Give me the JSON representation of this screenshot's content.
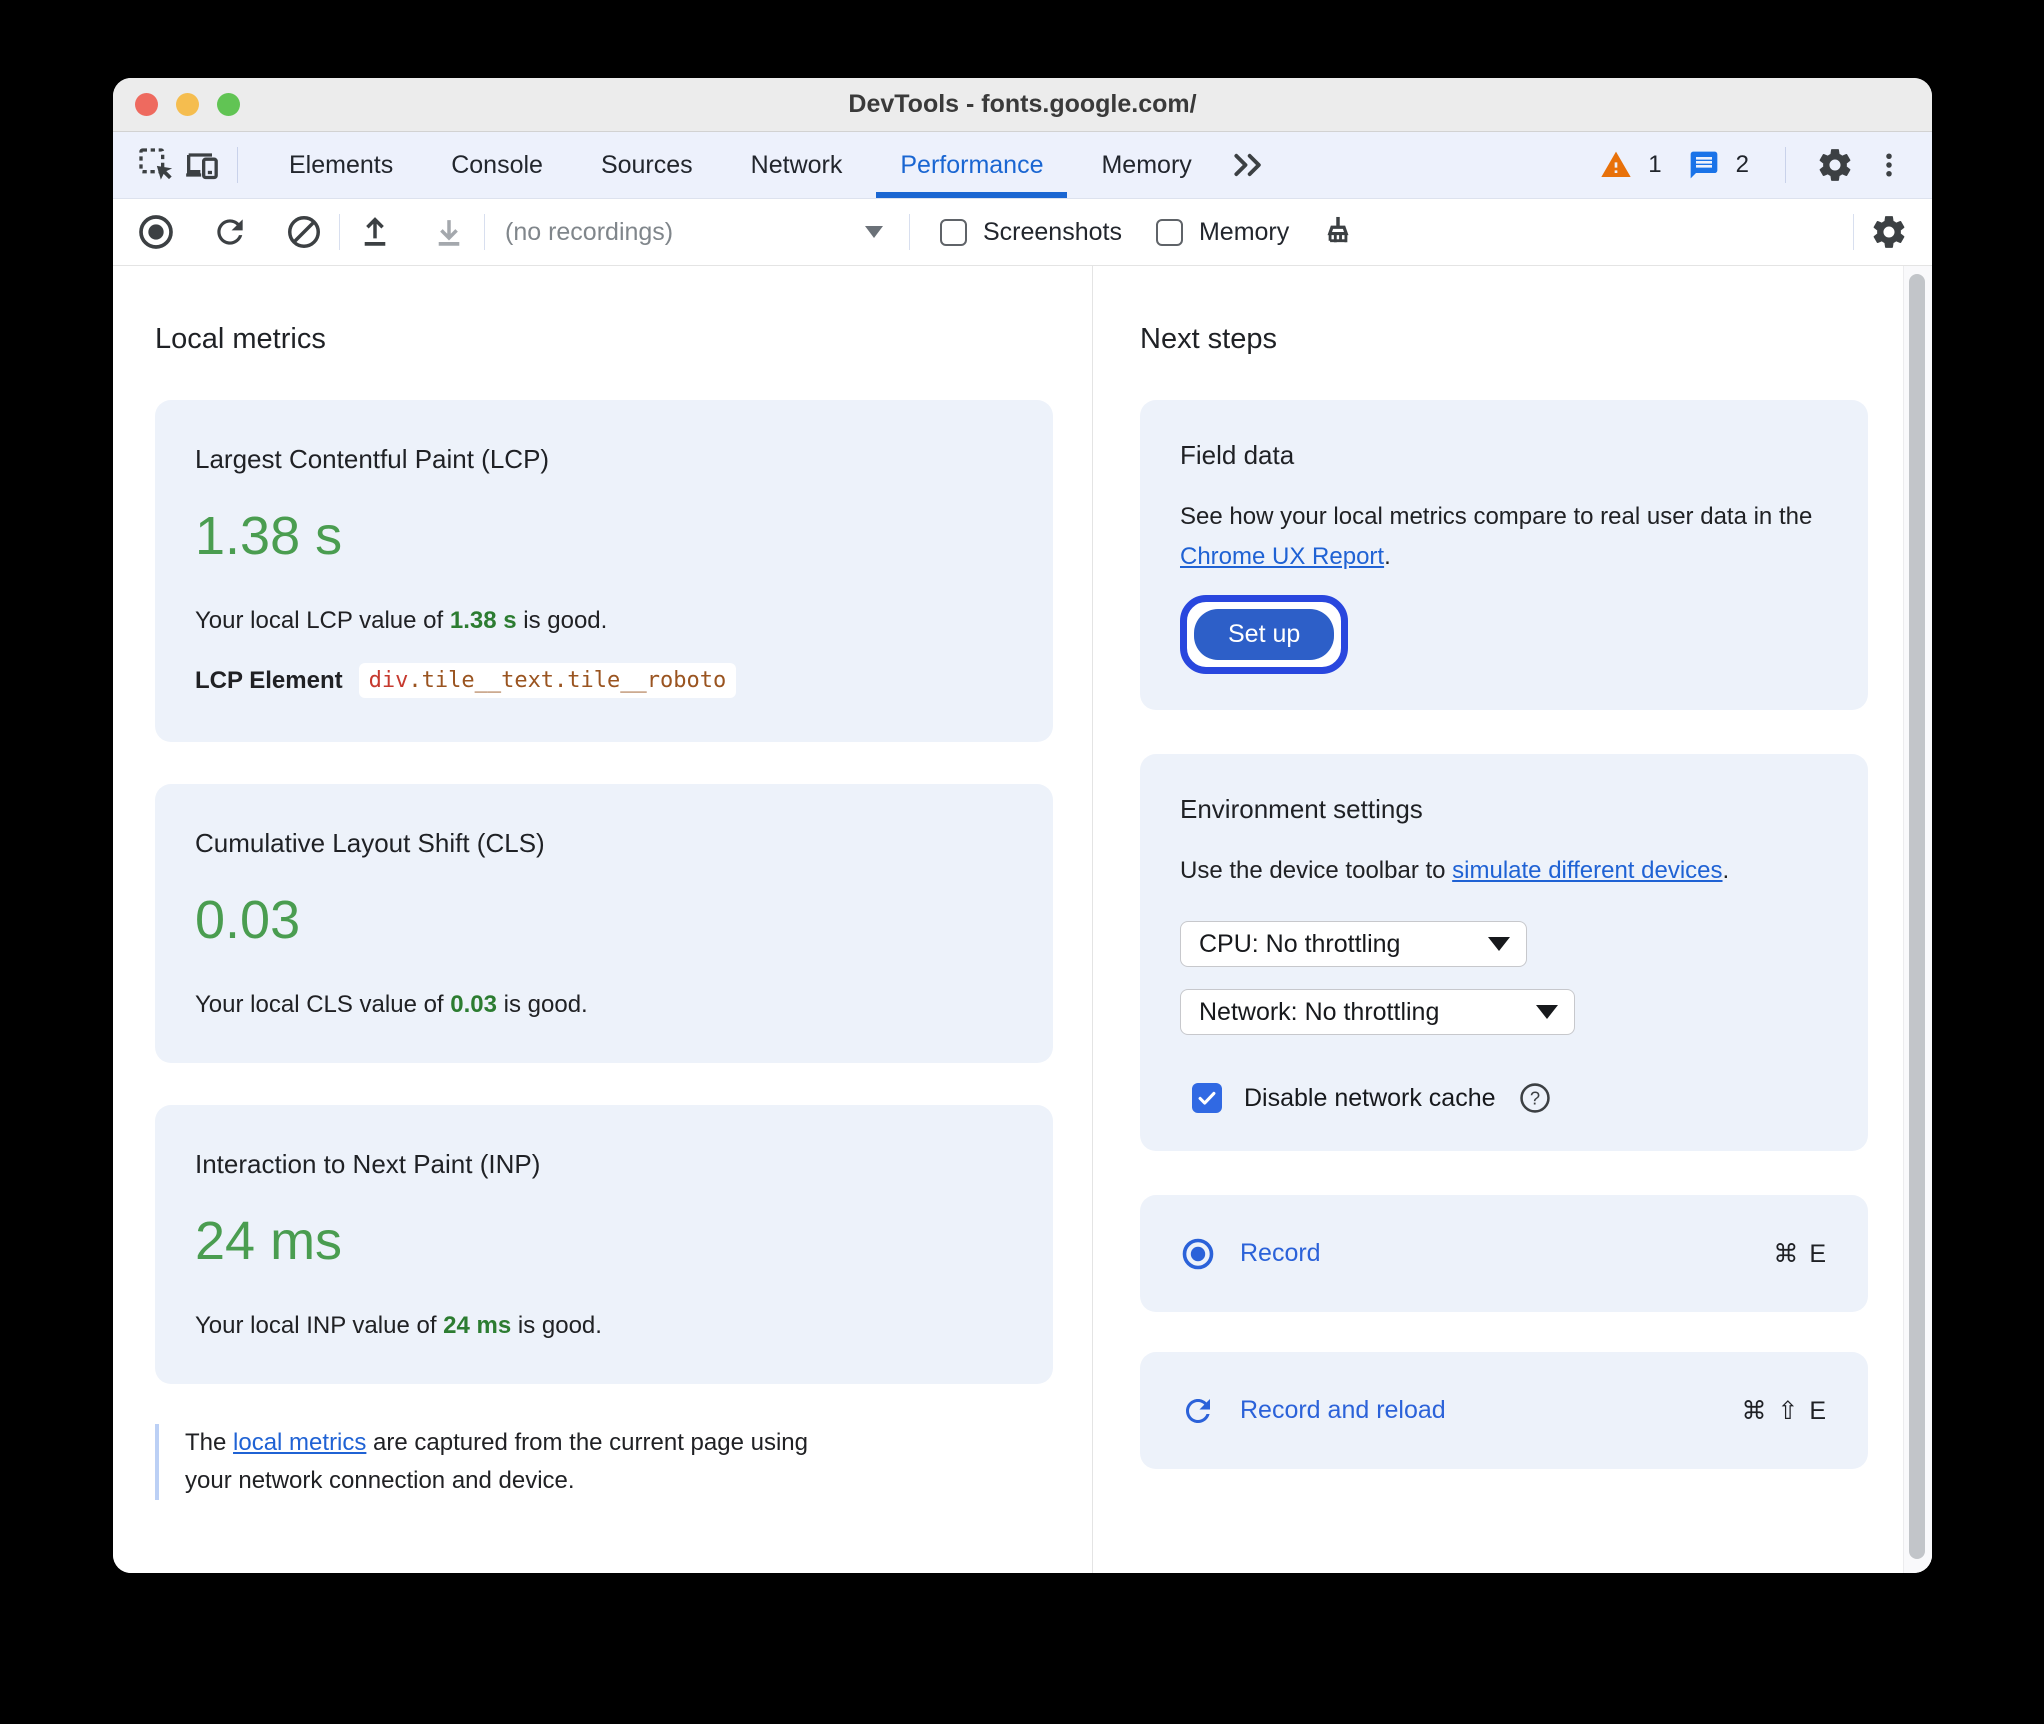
{
  "window": {
    "title": "DevTools - fonts.google.com/"
  },
  "tabs": {
    "items": [
      "Elements",
      "Console",
      "Sources",
      "Network",
      "Performance",
      "Memory"
    ],
    "active": "Performance",
    "warning_count": "1",
    "message_count": "2"
  },
  "toolbar": {
    "recordings_placeholder": "(no recordings)",
    "screenshots_label": "Screenshots",
    "memory_label": "Memory"
  },
  "local_metrics": {
    "heading": "Local metrics",
    "cards": [
      {
        "title": "Largest Contentful Paint (LCP)",
        "value": "1.38 s",
        "sentence_prefix": "Your local LCP value of ",
        "sentence_value": "1.38 s",
        "sentence_suffix": " is good.",
        "element_label": "LCP Element",
        "element_tag": "div",
        "element_classes": ".tile__text.tile__roboto"
      },
      {
        "title": "Cumulative Layout Shift (CLS)",
        "value": "0.03",
        "sentence_prefix": "Your local CLS value of ",
        "sentence_value": "0.03",
        "sentence_suffix": " is good."
      },
      {
        "title": "Interaction to Next Paint (INP)",
        "value": "24 ms",
        "sentence_prefix": "Your local INP value of ",
        "sentence_value": "24 ms",
        "sentence_suffix": " is good."
      }
    ],
    "footnote": {
      "prefix": "The ",
      "link": "local metrics",
      "suffix": " are captured from the current page using your network connection and device."
    }
  },
  "next_steps": {
    "heading": "Next steps",
    "field_data": {
      "title": "Field data",
      "body_prefix": "See how your local metrics compare to real user data in the ",
      "link": "Chrome UX Report",
      "body_suffix": ".",
      "button_label": "Set up"
    },
    "environment": {
      "title": "Environment settings",
      "body_prefix": "Use the device toolbar to ",
      "link": "simulate different devices",
      "body_suffix": ".",
      "cpu_select": "CPU: No throttling",
      "network_select": "Network: No throttling",
      "checkbox_label": "Disable network cache"
    },
    "record": {
      "label": "Record",
      "shortcut": "⌘ E"
    },
    "record_reload": {
      "label": "Record and reload",
      "shortcut": "⌘ ⇧ E"
    }
  },
  "colors": {
    "accent_blue": "#1a66d2",
    "link_blue": "#1f62d4",
    "button_blue": "#2d5fc8",
    "focus_ring_blue": "#2947de",
    "checkbox_blue": "#3069e3",
    "good_green_large": "#4a9d50",
    "good_green_inline": "#2c7c31",
    "warning_orange": "#e8710a",
    "card_background": "#edf2fa",
    "element_tag_red": "#c6392e",
    "element_class_brown": "#9a5420"
  }
}
